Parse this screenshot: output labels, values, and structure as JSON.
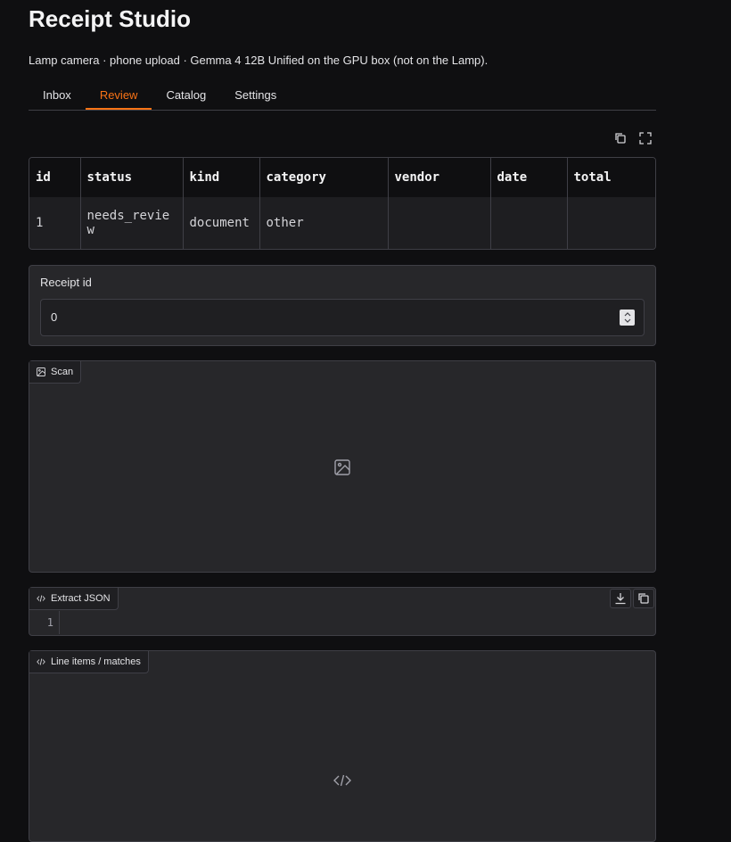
{
  "header": {
    "title": "Receipt Studio",
    "subtitle": "Lamp camera · phone upload · Gemma 4 12B Unified on the GPU box (not on the Lamp)."
  },
  "tabs": [
    {
      "label": "Inbox",
      "active": false
    },
    {
      "label": "Review",
      "active": true
    },
    {
      "label": "Catalog",
      "active": false
    },
    {
      "label": "Settings",
      "active": false
    }
  ],
  "table": {
    "columns": [
      "id",
      "status",
      "kind",
      "category",
      "vendor",
      "date",
      "total"
    ],
    "rows": [
      [
        "1",
        "needs_review",
        "document",
        "other",
        "",
        "",
        ""
      ]
    ]
  },
  "receipt_field": {
    "label": "Receipt id",
    "value": "0"
  },
  "scan": {
    "label": "Scan",
    "icon": "image-icon"
  },
  "extract_json": {
    "label": "Extract JSON",
    "line_number": "1"
  },
  "line_items": {
    "label": "Line items / matches",
    "icon": "code-icon"
  },
  "colors": {
    "accent": "#f97316",
    "background": "#0f0f11",
    "panel": "#27272a",
    "border": "#3f3f46"
  }
}
